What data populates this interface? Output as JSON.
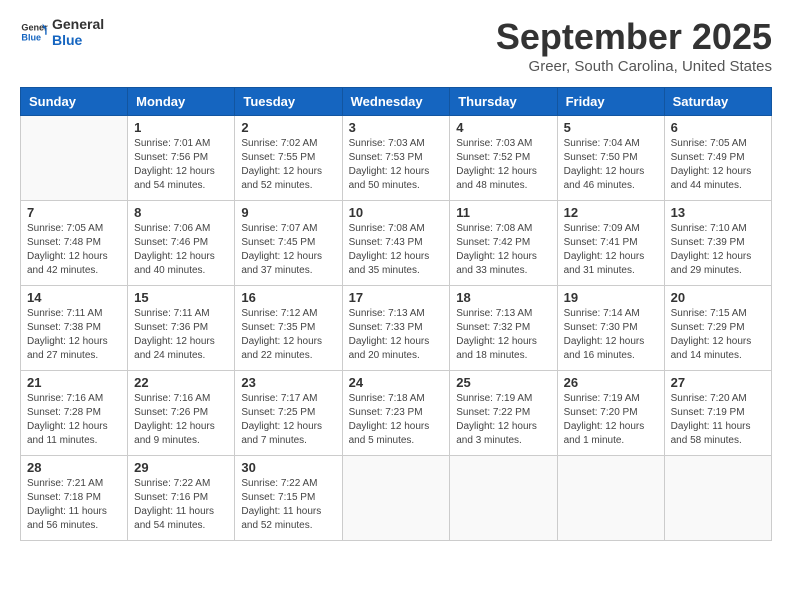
{
  "logo": {
    "line1": "General",
    "line2": "Blue"
  },
  "title": "September 2025",
  "location": "Greer, South Carolina, United States",
  "days_of_week": [
    "Sunday",
    "Monday",
    "Tuesday",
    "Wednesday",
    "Thursday",
    "Friday",
    "Saturday"
  ],
  "weeks": [
    [
      {
        "day": "",
        "info": ""
      },
      {
        "day": "1",
        "info": "Sunrise: 7:01 AM\nSunset: 7:56 PM\nDaylight: 12 hours\nand 54 minutes."
      },
      {
        "day": "2",
        "info": "Sunrise: 7:02 AM\nSunset: 7:55 PM\nDaylight: 12 hours\nand 52 minutes."
      },
      {
        "day": "3",
        "info": "Sunrise: 7:03 AM\nSunset: 7:53 PM\nDaylight: 12 hours\nand 50 minutes."
      },
      {
        "day": "4",
        "info": "Sunrise: 7:03 AM\nSunset: 7:52 PM\nDaylight: 12 hours\nand 48 minutes."
      },
      {
        "day": "5",
        "info": "Sunrise: 7:04 AM\nSunset: 7:50 PM\nDaylight: 12 hours\nand 46 minutes."
      },
      {
        "day": "6",
        "info": "Sunrise: 7:05 AM\nSunset: 7:49 PM\nDaylight: 12 hours\nand 44 minutes."
      }
    ],
    [
      {
        "day": "7",
        "info": "Sunrise: 7:05 AM\nSunset: 7:48 PM\nDaylight: 12 hours\nand 42 minutes."
      },
      {
        "day": "8",
        "info": "Sunrise: 7:06 AM\nSunset: 7:46 PM\nDaylight: 12 hours\nand 40 minutes."
      },
      {
        "day": "9",
        "info": "Sunrise: 7:07 AM\nSunset: 7:45 PM\nDaylight: 12 hours\nand 37 minutes."
      },
      {
        "day": "10",
        "info": "Sunrise: 7:08 AM\nSunset: 7:43 PM\nDaylight: 12 hours\nand 35 minutes."
      },
      {
        "day": "11",
        "info": "Sunrise: 7:08 AM\nSunset: 7:42 PM\nDaylight: 12 hours\nand 33 minutes."
      },
      {
        "day": "12",
        "info": "Sunrise: 7:09 AM\nSunset: 7:41 PM\nDaylight: 12 hours\nand 31 minutes."
      },
      {
        "day": "13",
        "info": "Sunrise: 7:10 AM\nSunset: 7:39 PM\nDaylight: 12 hours\nand 29 minutes."
      }
    ],
    [
      {
        "day": "14",
        "info": "Sunrise: 7:11 AM\nSunset: 7:38 PM\nDaylight: 12 hours\nand 27 minutes."
      },
      {
        "day": "15",
        "info": "Sunrise: 7:11 AM\nSunset: 7:36 PM\nDaylight: 12 hours\nand 24 minutes."
      },
      {
        "day": "16",
        "info": "Sunrise: 7:12 AM\nSunset: 7:35 PM\nDaylight: 12 hours\nand 22 minutes."
      },
      {
        "day": "17",
        "info": "Sunrise: 7:13 AM\nSunset: 7:33 PM\nDaylight: 12 hours\nand 20 minutes."
      },
      {
        "day": "18",
        "info": "Sunrise: 7:13 AM\nSunset: 7:32 PM\nDaylight: 12 hours\nand 18 minutes."
      },
      {
        "day": "19",
        "info": "Sunrise: 7:14 AM\nSunset: 7:30 PM\nDaylight: 12 hours\nand 16 minutes."
      },
      {
        "day": "20",
        "info": "Sunrise: 7:15 AM\nSunset: 7:29 PM\nDaylight: 12 hours\nand 14 minutes."
      }
    ],
    [
      {
        "day": "21",
        "info": "Sunrise: 7:16 AM\nSunset: 7:28 PM\nDaylight: 12 hours\nand 11 minutes."
      },
      {
        "day": "22",
        "info": "Sunrise: 7:16 AM\nSunset: 7:26 PM\nDaylight: 12 hours\nand 9 minutes."
      },
      {
        "day": "23",
        "info": "Sunrise: 7:17 AM\nSunset: 7:25 PM\nDaylight: 12 hours\nand 7 minutes."
      },
      {
        "day": "24",
        "info": "Sunrise: 7:18 AM\nSunset: 7:23 PM\nDaylight: 12 hours\nand 5 minutes."
      },
      {
        "day": "25",
        "info": "Sunrise: 7:19 AM\nSunset: 7:22 PM\nDaylight: 12 hours\nand 3 minutes."
      },
      {
        "day": "26",
        "info": "Sunrise: 7:19 AM\nSunset: 7:20 PM\nDaylight: 12 hours\nand 1 minute."
      },
      {
        "day": "27",
        "info": "Sunrise: 7:20 AM\nSunset: 7:19 PM\nDaylight: 11 hours\nand 58 minutes."
      }
    ],
    [
      {
        "day": "28",
        "info": "Sunrise: 7:21 AM\nSunset: 7:18 PM\nDaylight: 11 hours\nand 56 minutes."
      },
      {
        "day": "29",
        "info": "Sunrise: 7:22 AM\nSunset: 7:16 PM\nDaylight: 11 hours\nand 54 minutes."
      },
      {
        "day": "30",
        "info": "Sunrise: 7:22 AM\nSunset: 7:15 PM\nDaylight: 11 hours\nand 52 minutes."
      },
      {
        "day": "",
        "info": ""
      },
      {
        "day": "",
        "info": ""
      },
      {
        "day": "",
        "info": ""
      },
      {
        "day": "",
        "info": ""
      }
    ]
  ]
}
